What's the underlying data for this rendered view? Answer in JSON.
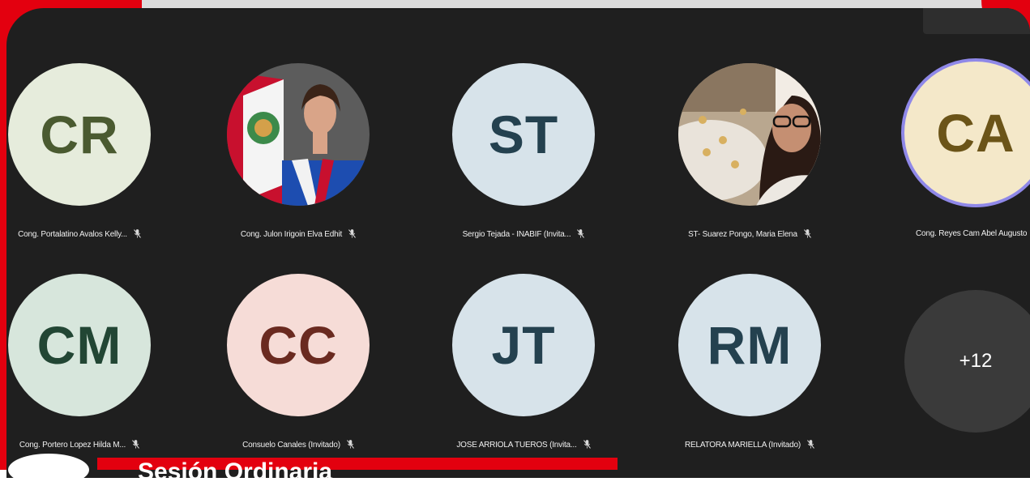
{
  "participants": [
    {
      "initials": "CR",
      "name": "Cong. Portalatino Avalos Kelly...",
      "bg": "#e6ecdc",
      "fg": "#4a5a30"
    },
    {
      "initials": "",
      "name": "Cong. Julon Irigoin Elva Edhit",
      "photo": true
    },
    {
      "initials": "ST",
      "name": "Sergio Tejada - INABIF (Invita...",
      "bg": "#d7e3ea",
      "fg": "#24414f"
    },
    {
      "initials": "",
      "name": "ST- Suarez Pongo, Maria Elena",
      "photo": true
    },
    {
      "initials": "CA",
      "name": "Cong. Reyes Cam Abel Augusto",
      "bg": "#f4e8c9",
      "fg": "#6b5418"
    },
    {
      "initials": "CM",
      "name": "Cong. Portero Lopez Hilda M...",
      "bg": "#d7e6dc",
      "fg": "#224634"
    },
    {
      "initials": "CC",
      "name": "Consuelo Canales (Invitado)",
      "bg": "#f6dcd7",
      "fg": "#6a2a20"
    },
    {
      "initials": "JT",
      "name": "JOSE ARRIOLA TUEROS (Invita...",
      "bg": "#d7e3ea",
      "fg": "#24414f"
    },
    {
      "initials": "RM",
      "name": "RELATORA MARIELLA (Invitado)",
      "bg": "#d7e3ea",
      "fg": "#24414f"
    }
  ],
  "more": {
    "label": "+12"
  },
  "banner": {
    "title": "Sesión Ordinaria"
  },
  "icons": {
    "mute": "mic-off-icon"
  },
  "colors": {
    "accent": "#e3000f",
    "panel": "#1f1f1f",
    "speaking_ring": "#8f88e8"
  }
}
